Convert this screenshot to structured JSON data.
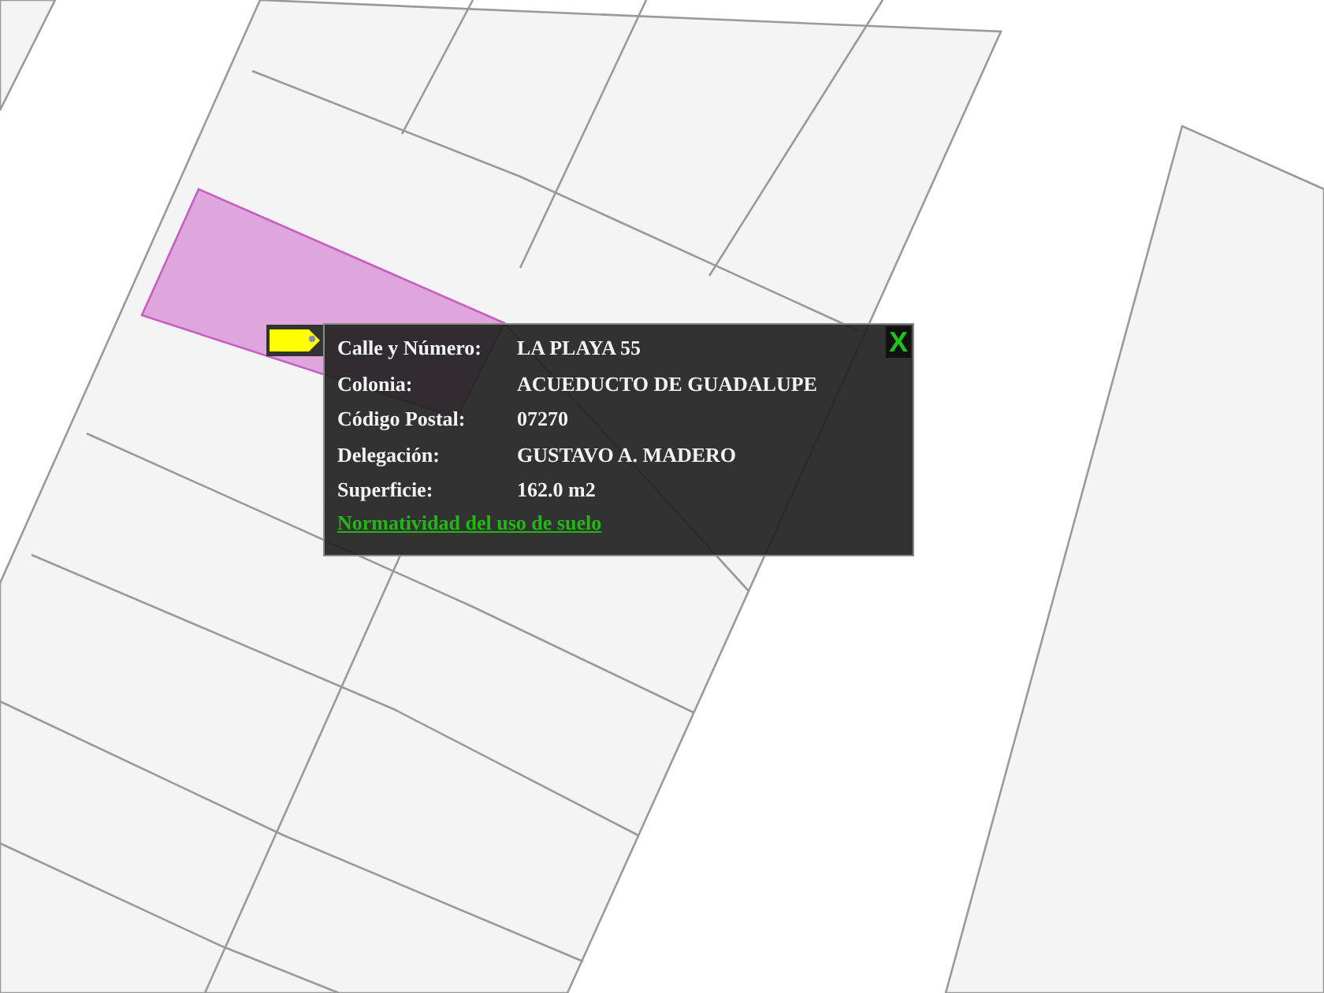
{
  "popup": {
    "close": "X",
    "fields": [
      {
        "label": "Calle y Número:",
        "value": "LA PLAYA 55"
      },
      {
        "label": "Colonia:",
        "value": "ACUEDUCTO DE GUADALUPE"
      },
      {
        "label": "Código Postal:",
        "value": "07270"
      },
      {
        "label": "Delegación:",
        "value": "GUSTAVO A. MADERO"
      },
      {
        "label": "Superficie:",
        "value": "162.0 m2"
      }
    ],
    "link": "Normatividad del uso de suelo"
  }
}
